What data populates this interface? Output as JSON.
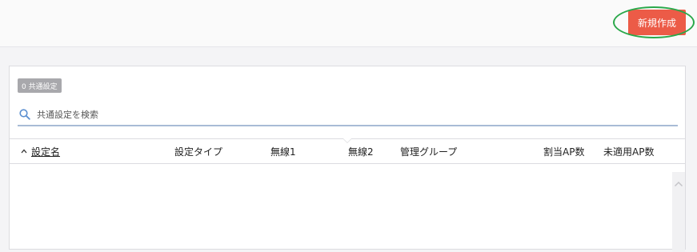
{
  "header": {
    "create_label": "新規作成"
  },
  "panel": {
    "badge": "0 共通設定",
    "search": {
      "placeholder": "共通設定を検索",
      "value": ""
    },
    "columns": [
      "設定名",
      "設定タイプ",
      "無線1",
      "無線2",
      "管理グループ",
      "割当AP数",
      "未適用AP数"
    ],
    "sort_icon": "chevron-up-icon",
    "rows": []
  },
  "colors": {
    "accent": "#ec5b47",
    "highlight": "#2aa84a",
    "search_underline": "#a8bbd6"
  }
}
